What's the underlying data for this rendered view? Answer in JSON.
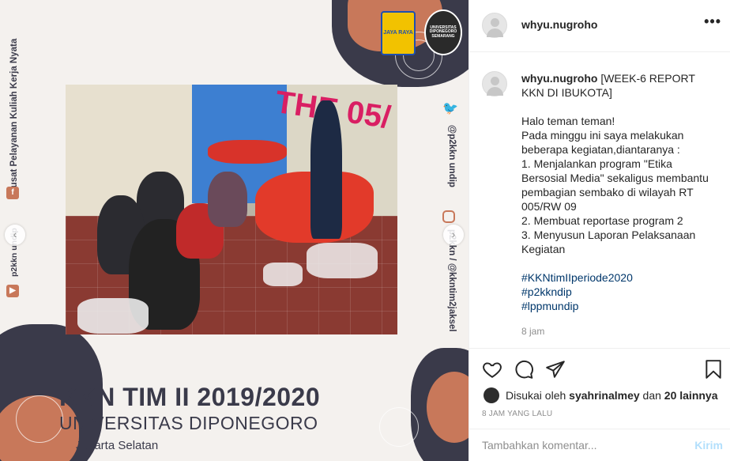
{
  "post_image": {
    "left_vertical": "Pusat Pelayanan Kuliah Kerja Nyata",
    "left_handle": "p2kkn undip",
    "right_handle_1": "@p2kkn undip",
    "right_handle_2": "p2kkn / @kkntim2jaksel",
    "logo_left": "JAYA RAYA",
    "logo_right": "UNIVERSITAS DIPONEGORO SEMARANG",
    "mural_text": "THE 05/",
    "title": "KKN TIM II 2019/2020",
    "subtitle": "UNIVERSITAS DIPONEGORO",
    "location": "Jakarta Selatan"
  },
  "header": {
    "username": "whyu.nugroho",
    "more": "•••"
  },
  "caption": {
    "username": "whyu.nugroho",
    "title": "[WEEK-6 REPORT KKN DI IBUKOTA]",
    "greeting": "Halo teman teman!",
    "intro": "Pada minggu ini saya melakukan beberapa kegiatan,diantaranya :",
    "item1": "1. Menjalankan program \"Etika Bersosial Media\" sekaligus membantu pembagian sembako di wilayah RT 005/RW 09",
    "item2": "2. Membuat reportase program 2",
    "item3": "3. Menyusun Laporan Pelaksanaan Kegiatan",
    "tags": [
      "#KKNtimIIperiode2020",
      "#p2kkndip",
      "#lppmundip"
    ],
    "time": "8 jam"
  },
  "engagement": {
    "liked_prefix": "Disukai oleh",
    "liked_user": "syahrinalmey",
    "liked_mid": "dan",
    "liked_count": "20 lainnya",
    "timestamp": "8 JAM YANG LALU"
  },
  "comment": {
    "placeholder": "Tambahkan komentar...",
    "post_label": "Kirim"
  },
  "colors": {
    "accent_link": "#00376b",
    "post_button_disabled": "#b2dffc",
    "brand_dark": "#3a3a4a",
    "brand_copper": "#c8785a"
  }
}
